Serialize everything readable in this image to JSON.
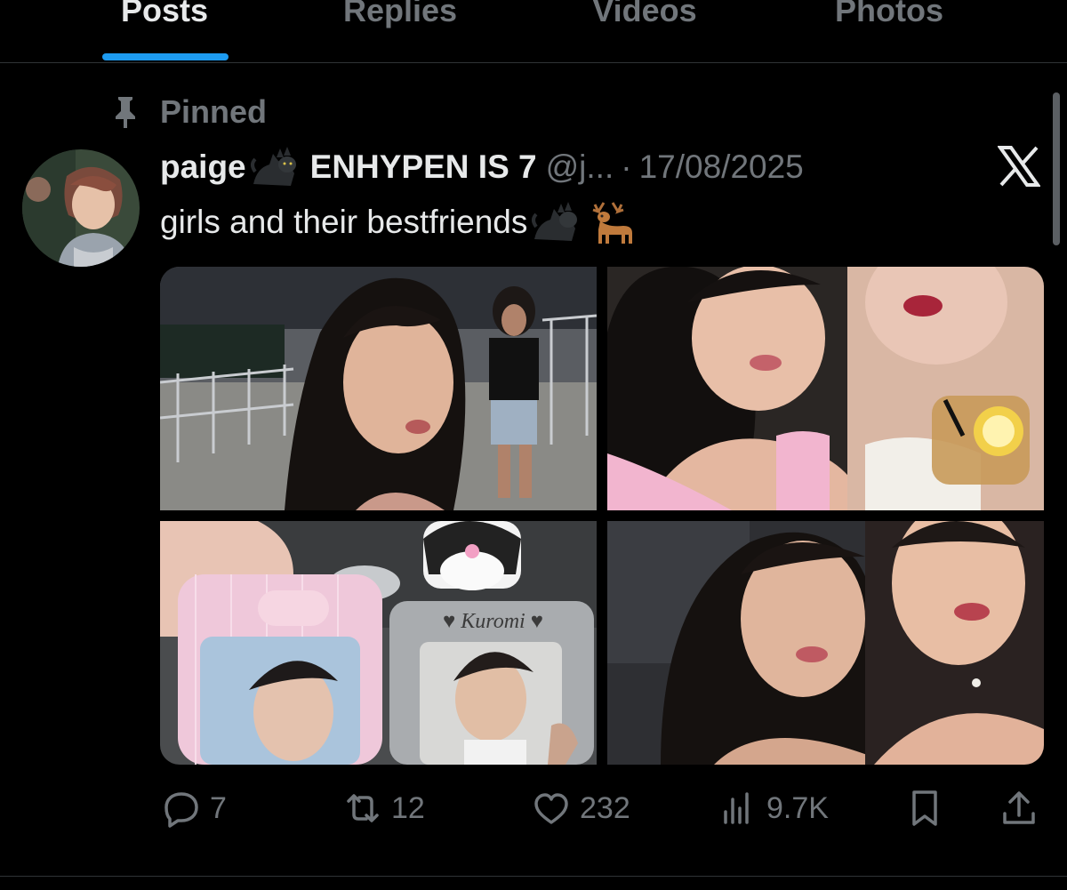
{
  "tabs": [
    {
      "label": "Posts",
      "active": true
    },
    {
      "label": "Replies",
      "active": false
    },
    {
      "label": "Videos",
      "active": false
    },
    {
      "label": "Photos",
      "active": false
    }
  ],
  "pinned": {
    "label": "Pinned",
    "icon": "pin-icon"
  },
  "tweet": {
    "display_name": "paige",
    "display_name_suffix": "ENHYPEN IS 7",
    "handle": "@j...",
    "separator": "·",
    "date": "17/08/2025",
    "text": "girls and their bestfriends",
    "emojis": [
      "black-cat-emoji",
      "deer-emoji"
    ],
    "photos": [
      {
        "name": "photo-selfie-stadium"
      },
      {
        "name": "photo-selfie-two-girls-drink"
      },
      {
        "name": "photo-photocard-holders",
        "caption_text": "Kuromi"
      },
      {
        "name": "photo-selfie-two-girls"
      }
    ]
  },
  "actions": {
    "replies": "7",
    "reposts": "12",
    "likes": "232",
    "views": "9.7K"
  },
  "colors": {
    "background": "#000000",
    "text": "#e7e9ea",
    "muted": "#71767b",
    "accent": "#1d9bf0",
    "divider": "#2f3336"
  }
}
